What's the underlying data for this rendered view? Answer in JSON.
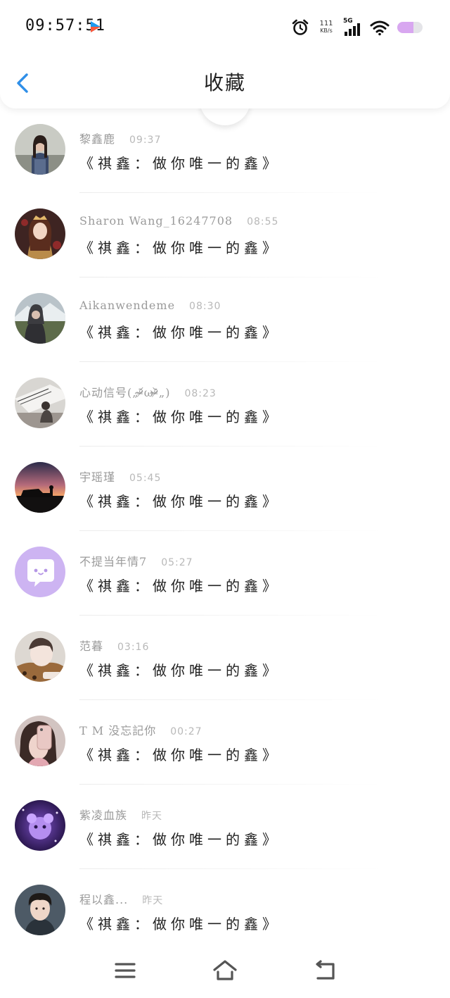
{
  "status_bar": {
    "time": "09:57:51",
    "net_speed_value": "111",
    "net_speed_unit": "KB/s",
    "network_label": "5G",
    "icons": [
      "app-badge-icon",
      "alarm-icon",
      "signal-icon",
      "wifi-icon",
      "battery-icon"
    ]
  },
  "header": {
    "title": "收藏",
    "back_icon": "chevron-left-icon"
  },
  "items": [
    {
      "sender": "黎鑫鹿",
      "time": "09:37",
      "message": "《祺鑫：做你唯一的鑫》"
    },
    {
      "sender": "Sharon Wang_16247708",
      "time": "08:55",
      "message": "《祺鑫：做你唯一的鑫》"
    },
    {
      "sender": "Aikanwendeme",
      "time": "08:30",
      "message": "《祺鑫：做你唯一的鑫》"
    },
    {
      "sender": "心动信号(„ᵒ̴̶̷᷄ωᵒ̴̶̷᷅„)",
      "time": "08:23",
      "message": "《祺鑫：做你唯一的鑫》"
    },
    {
      "sender": "宇瑶瑾",
      "time": "05:45",
      "message": "《祺鑫：做你唯一的鑫》"
    },
    {
      "sender": "不提当年情7",
      "time": "05:27",
      "message": "《祺鑫：做你唯一的鑫》"
    },
    {
      "sender": "范暮",
      "time": "03:16",
      "message": "《祺鑫：做你唯一的鑫》"
    },
    {
      "sender": "T M 没忘記你",
      "time": "00:27",
      "message": "《祺鑫：做你唯一的鑫》"
    },
    {
      "sender": "紫凌血族",
      "time": "昨天",
      "message": "《祺鑫：做你唯一的鑫》"
    },
    {
      "sender": "程以鑫...",
      "time": "昨天",
      "message": "《祺鑫：做你唯一的鑫》"
    }
  ],
  "nav_bar": {
    "icons": [
      "menu-icon",
      "home-icon",
      "back-icon"
    ]
  },
  "colors": {
    "accent": "#2f8fe8",
    "sender_text": "#9a9a9a",
    "time_text": "#b8b8b8",
    "message_text": "#222222",
    "default_avatar_bg": "#cdb4f2"
  }
}
